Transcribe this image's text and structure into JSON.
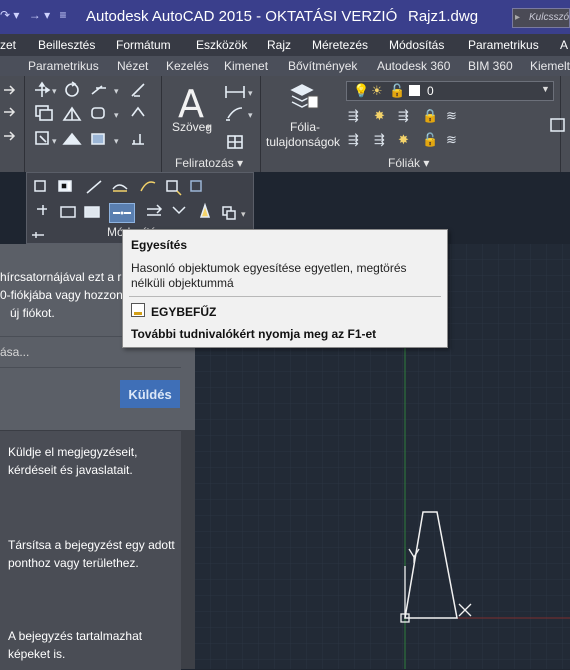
{
  "titlebar": {
    "app_title": "Autodesk AutoCAD 2015 - OKTATÁSI VERZIÓ",
    "file_name": "Rajz1.dwg",
    "search_placeholder": "Kulcsszó vagy",
    "accent_color": "#3a3f8c"
  },
  "menubar": {
    "items": [
      "zet",
      "Beillesztés",
      "Formátum",
      "Eszközök",
      "Rajz",
      "Méretezés",
      "Módosítás",
      "Parametrikus",
      "A"
    ]
  },
  "tabs": {
    "items": [
      "Parametrikus",
      "Nézet",
      "Kezelés",
      "Kimenet",
      "Bővítmények",
      "Autodesk 360",
      "BIM 360",
      "Kiemelt"
    ]
  },
  "ribbon": {
    "text_button": "Szöveg",
    "layer_props_line1": "Fólia-",
    "layer_props_line2": "tulajdonságok",
    "annotation_panel": "Feliratozás ▾",
    "layers_panel": "Fóliák ▾",
    "layer_value": "0",
    "modify_panel": "Módosítás"
  },
  "tooltip": {
    "title": "Egyesítés",
    "description": "Hasonló objektumok egyesítése egyetlen, megtörés nélküli objektummá",
    "command": "EGYBEFŰZ",
    "help": "További tudnivalókért nyomja meg az F1-et"
  },
  "leftpanel": {
    "line1": "hírcsatornájával ezt a raj",
    "line2": "0-fiókjába vagy hozzon",
    "line3": "új fiókot.",
    "input_placeholder": "ása...",
    "send_button": "Küldés",
    "tip1_line1": "Küldje el megjegyzéseit,",
    "tip1_line2": "kérdéseit és javaslatait.",
    "tip2_line1": "Társítsa a bejegyzést egy adott",
    "tip2_line2": "ponthoz vagy területhez.",
    "tip3_line1": "A bejegyzés tartalmazhat",
    "tip3_line2": "képeket is."
  }
}
